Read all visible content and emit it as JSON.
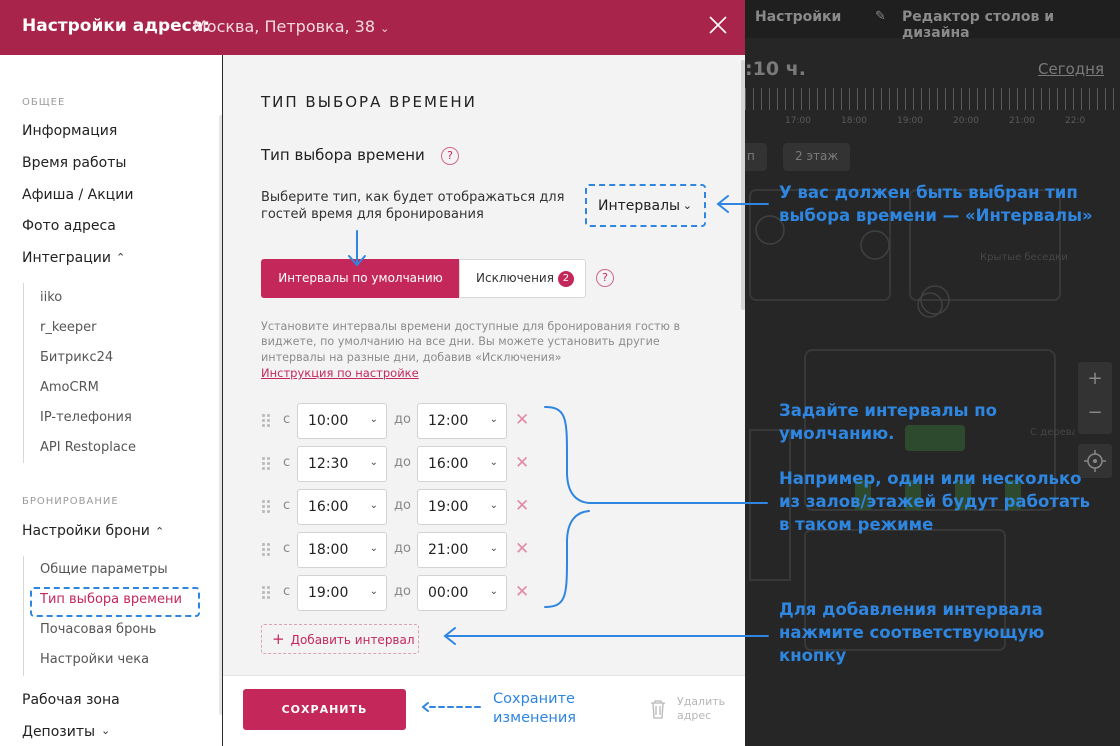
{
  "background": {
    "top_items": [
      "Настройки",
      "Редактор столов и дизайна"
    ],
    "time": ":10 ч.",
    "today": "Сегодня",
    "hours": [
      "17:00",
      "18:00",
      "19:00",
      "20:00",
      "21:00",
      "22:0"
    ],
    "floor_pills": [
      "п",
      "2 этаж"
    ],
    "zoom_in": "+",
    "zoom_out": "−",
    "map_label1": "Крытые беседки",
    "map_label2": "С дерева"
  },
  "header": {
    "title": "Настройки адреса:",
    "address": "Москва, Петровка, 38"
  },
  "sidebar": {
    "section_general": "ОБЩЕЕ",
    "general_items": [
      "Информация",
      "Время работы",
      "Афиша / Акции",
      "Фото адреса",
      "Интеграции"
    ],
    "integrations": [
      "iiko",
      "r_keeper",
      "Битрикс24",
      "AmoCRM",
      "IP-телефония",
      "API Restoplace"
    ],
    "section_booking": "БРОНИРОВАНИЕ",
    "booking_item": "Настройки брони",
    "booking_sub": [
      "Общие параметры",
      "Тип выбора времени",
      "Почасовая бронь",
      "Настройки чека"
    ],
    "bottom_items": [
      "Рабочая зона",
      "Депозиты"
    ]
  },
  "main": {
    "heading": "ТИП ВЫБОРА ВРЕМЕНИ",
    "subheading": "Тип выбора времени",
    "help": "?",
    "description": "Выберите тип, как будет отображаться для гостей время для бронирования",
    "select_value": "Интервалы",
    "tab_default": "Интервалы по умолчанию",
    "tab_exceptions": "Исключения",
    "exceptions_count": "2",
    "info": "Установите интервалы времени доступные для бронирования гостю в виджете, по умолчанию на все дни. Вы можете установить другие интервалы на разные дни, добавив «Исключения»",
    "instruction_link": "Инструкция по настройке",
    "from_label": "с",
    "to_label": "до",
    "intervals": [
      {
        "from": "10:00",
        "to": "12:00"
      },
      {
        "from": "12:30",
        "to": "16:00"
      },
      {
        "from": "16:00",
        "to": "19:00"
      },
      {
        "from": "18:00",
        "to": "21:00"
      },
      {
        "from": "19:00",
        "to": "00:00"
      }
    ],
    "add_interval": "Добавить интервал"
  },
  "footer": {
    "save": "СОХРАНИТЬ",
    "save_note": "Сохраните изменения",
    "delete_address": "Удалить адрес"
  },
  "annotations": {
    "select_type": "У вас должен быть выбран тип выбора времени — «Интервалы»",
    "set_intervals": "Задайте интервалы по умолчанию.",
    "example": "Например, один или несколько из залов/этажей будут работать в таком режиме",
    "add_interval": "Для добавления интервала нажмите соответствующую кнопку"
  },
  "colors": {
    "brand": "#a8244a",
    "accent": "#c4285a",
    "annotation": "#2f86e0"
  }
}
